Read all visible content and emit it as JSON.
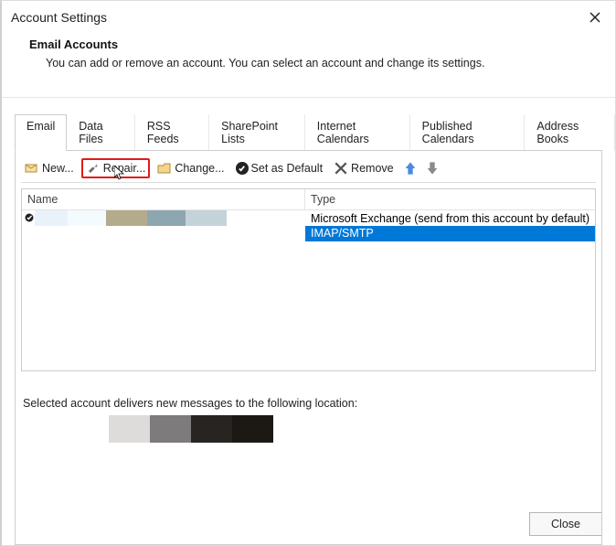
{
  "window": {
    "title": "Account Settings"
  },
  "header": {
    "title": "Email Accounts",
    "subtitle": "You can add or remove an account. You can select an account and change its settings."
  },
  "tabs": [
    {
      "label": "Email",
      "active": true
    },
    {
      "label": "Data Files"
    },
    {
      "label": "RSS Feeds"
    },
    {
      "label": "SharePoint Lists"
    },
    {
      "label": "Internet Calendars"
    },
    {
      "label": "Published Calendars"
    },
    {
      "label": "Address Books"
    }
  ],
  "toolbar": {
    "new": "New...",
    "repair": "Repair...",
    "change": "Change...",
    "setDefault": "Set as Default",
    "remove": "Remove"
  },
  "list": {
    "columns": {
      "name": "Name",
      "type": "Type"
    },
    "rows": [
      {
        "default": true,
        "selected": false,
        "type": "Microsoft Exchange (send from this account by default)",
        "nameSwatches": [
          "#e9f2fb",
          "#f4fbff",
          "#b4ab8c",
          "#8ea6b0",
          "#c4d2da"
        ],
        "nameSwatchWidths": [
          36,
          42,
          45,
          42,
          45
        ]
      },
      {
        "default": false,
        "selected": true,
        "type": "IMAP/SMTP",
        "nameSwatches": [],
        "nameSwatchWidths": []
      }
    ]
  },
  "footer": {
    "message": "Selected account delivers new messages to the following location:",
    "swatches": [
      "#dedcdb",
      "#7d7b7b",
      "#272421",
      "#1c1915"
    ],
    "swatchWidths": [
      45,
      45,
      45,
      45
    ]
  },
  "buttons": {
    "close": "Close"
  }
}
